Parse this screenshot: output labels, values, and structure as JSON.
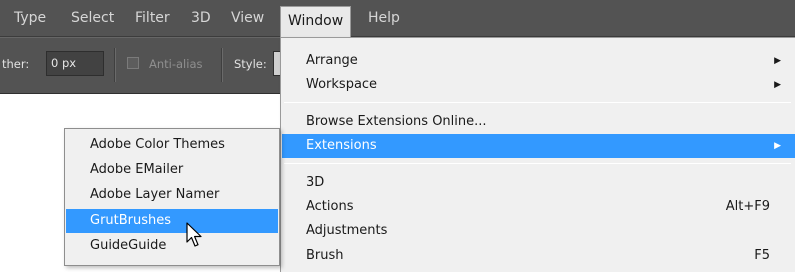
{
  "menubar": {
    "items": [
      "Type",
      "Select",
      "Filter",
      "3D",
      "View",
      "Window",
      "Help"
    ],
    "active": "Window"
  },
  "options_bar": {
    "feather_label": "ther:",
    "feather_value": "0 px",
    "antialias_label": "Anti-alias",
    "style_label": "Style:"
  },
  "window_menu": {
    "items": [
      {
        "label": "Arrange",
        "submenu_arrow": "▶"
      },
      {
        "label": "Workspace",
        "submenu_arrow": "▶"
      },
      {
        "label": "Browse Extensions Online..."
      },
      {
        "label": "Extensions",
        "submenu_arrow": "▶",
        "highlighted": true
      },
      {
        "label": "3D"
      },
      {
        "label": "Actions",
        "shortcut": "Alt+F9"
      },
      {
        "label": "Adjustments"
      },
      {
        "label": "Brush",
        "shortcut": "F5"
      }
    ]
  },
  "extensions_submenu": {
    "items": [
      {
        "label": "Adobe Color Themes"
      },
      {
        "label": "Adobe EMailer"
      },
      {
        "label": "Adobe Layer Namer"
      },
      {
        "label": "GrutBrushes",
        "highlighted": true
      },
      {
        "label": "GuideGuide"
      }
    ]
  },
  "colors": {
    "highlight": "#3399ff",
    "menubar_bg": "#535353",
    "menu_bg": "#f0f0f0"
  },
  "icons": [
    "submenu-arrow-icon",
    "mouse-pointer-icon"
  ]
}
